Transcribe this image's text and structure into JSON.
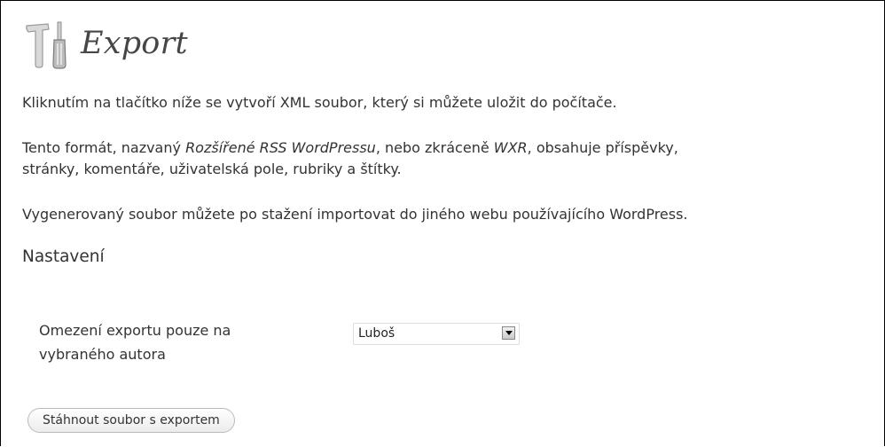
{
  "header": {
    "icon": "tools-icon",
    "title": "Export"
  },
  "intro": {
    "p1": "Kliknutím na tlačítko níže se vytvoří XML soubor, který si můžete uložit do počítače.",
    "p2_part1": "Tento formát, nazvaný ",
    "p2_em1": "Rozšířené RSS WordPressu",
    "p2_part2": ", nebo zkráceně ",
    "p2_em2": "WXR",
    "p2_part3": ", obsahuje příspěvky,",
    "p2_line2": "stránky, komentáře, uživatelská pole, rubriky a štítky.",
    "p3": "Vygenerovaný soubor můžete po stažení importovat do jiného webu používajícího WordPress."
  },
  "settings": {
    "heading": "Nastavení",
    "author_label_line1": "Omezení exportu pouze na",
    "author_label_line2": "vybraného autora",
    "author_selected": "Luboš"
  },
  "actions": {
    "download_label": "Stáhnout soubor s exportem"
  }
}
